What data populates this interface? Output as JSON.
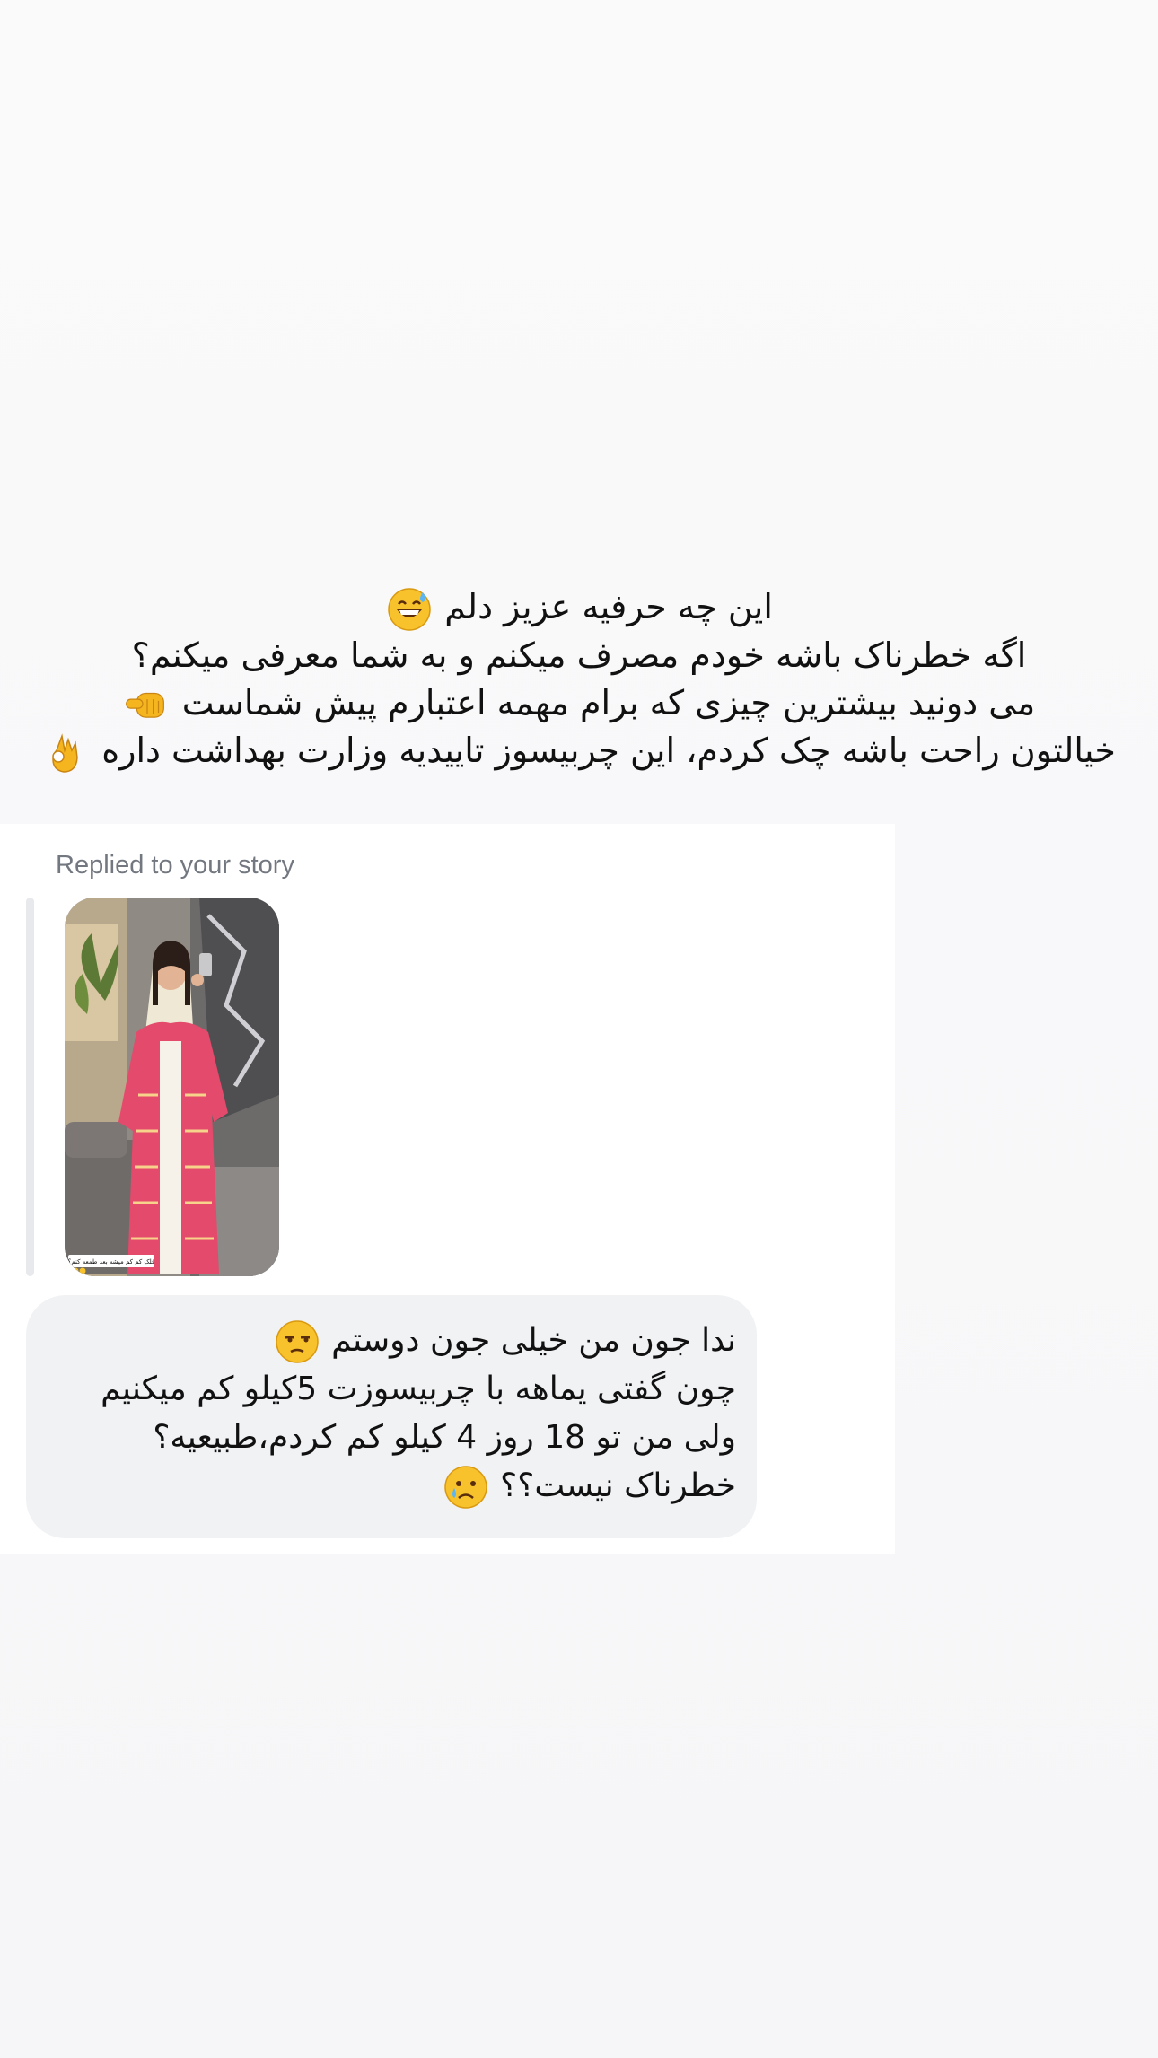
{
  "story_caption": {
    "lines": [
      {
        "text": "این چه حرفیه عزیز دلم",
        "emoji": "sweat-smile-emoji"
      },
      {
        "text": "اگه خطرناک باشه خودم مصرف میکنم و به شما معرفی میکنم؟",
        "emoji": ""
      },
      {
        "text": "می دونید بیشترین چیزی که برام مهمه اعتبارم پیش شماست",
        "emoji": "pointing-fist-emoji"
      },
      {
        "text": "خیالتون راحت باشه چک کردم، این چربیسوز تاییدیه وزارت بهداشت داره",
        "emoji": "ok-hand-emoji"
      }
    ]
  },
  "reply": {
    "label": "Replied to your story",
    "story_sticker_text": "قلک کم کم میشه بعد طمعه کنم؟"
  },
  "message": {
    "lines": [
      {
        "text": "ندا جون من خیلی جون دوستم",
        "emoji": "unamused-face-emoji"
      },
      {
        "text": "چون گفتی یماهه با چربیسوزت 5کیلو کم میکنیم",
        "emoji": ""
      },
      {
        "text": "ولی من تو 18 روز 4 کیلو کم کردم،طبیعیه؟",
        "emoji": ""
      },
      {
        "text": "خطرناک نیست؟؟",
        "emoji": "crying-face-emoji"
      }
    ]
  },
  "colors": {
    "background": "#f8f8fa",
    "panel": "#ffffff",
    "bubble": "#f1f2f4",
    "label": "#737880",
    "text": "#111111",
    "dress": "#e34a6b",
    "emoji_yellow": "#f8c22c"
  }
}
